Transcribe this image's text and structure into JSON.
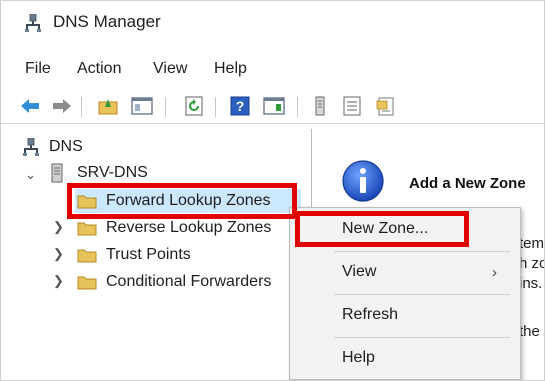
{
  "window": {
    "title": "DNS Manager"
  },
  "menu": [
    "File",
    "Action",
    "View",
    "Help"
  ],
  "toolbar": {
    "icons": [
      "back-arrow-icon",
      "forward-arrow-icon",
      "up-folder-icon",
      "show-hide-tree-icon",
      "refresh-icon",
      "help-icon",
      "show-hide-action-pane-icon",
      "server-icon",
      "list-icon",
      "properties-icon"
    ]
  },
  "tree": {
    "root": "DNS",
    "server": "SRV-DNS",
    "items": [
      "Forward Lookup Zones",
      "Reverse Lookup Zones",
      "Trust Points",
      "Conditional Forwarders"
    ]
  },
  "right_pane": {
    "heading": "Add a New Zone",
    "fragments": [
      "tem",
      "h zo",
      "ins.",
      "the"
    ]
  },
  "context_menu": {
    "items": [
      "New Zone...",
      "View",
      "Refresh",
      "Help"
    ]
  },
  "colors": {
    "highlight": "#e00000",
    "selection": "#cce8ff",
    "folder": "#e8c25a"
  }
}
